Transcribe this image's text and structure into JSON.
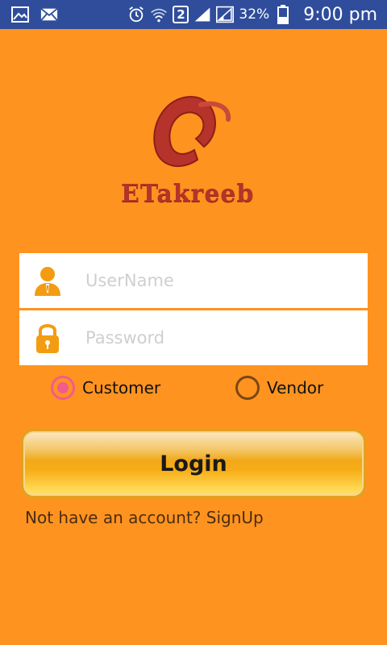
{
  "status_bar": {
    "sim_label": "2",
    "battery_percent": "32%",
    "time": "9:00 pm",
    "icons": [
      "gallery-icon",
      "mail-icon",
      "alarm-icon",
      "wifi-icon",
      "sim-icon",
      "signal-icon",
      "signal-icon-2",
      "battery-icon"
    ]
  },
  "logo": {
    "text": "ETakreeb"
  },
  "login_form": {
    "username": {
      "value": "",
      "placeholder": "UserName"
    },
    "password": {
      "value": "",
      "placeholder": "Password"
    },
    "account_type": {
      "options": [
        "Customer",
        "Vendor"
      ],
      "selected": "Customer"
    },
    "login_label": "Login",
    "signup_text": "Not have an account? SignUp"
  },
  "colors": {
    "background": "#ff9320",
    "status_bar": "#2f4d9b",
    "radio_accent": "#f35a8f",
    "logo_red": "#b5332a"
  }
}
